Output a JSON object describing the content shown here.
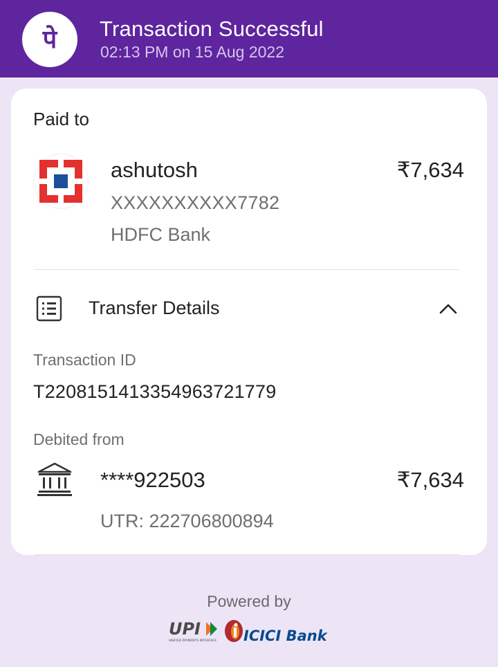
{
  "header": {
    "title": "Transaction Successful",
    "subtitle": "02:13 PM on 15 Aug 2022",
    "logo_glyph": "पे",
    "color": "#5f259f"
  },
  "paid_to": {
    "label": "Paid to",
    "name": "ashutosh",
    "account": "XXXXXXXXXX7782",
    "bank": "HDFC Bank",
    "amount": "₹7,634"
  },
  "transfer_details": {
    "title": "Transfer Details",
    "transaction_id_label": "Transaction ID",
    "transaction_id": "T2208151413354963721779",
    "debited_from_label": "Debited from",
    "debit_account": "****922503",
    "debit_amount": "₹7,634",
    "utr": "UTR: 222706800894"
  },
  "footer": {
    "powered_by": "Powered by",
    "upi_text": "UPI",
    "upi_tagline": "UNIFIED PAYMENTS INTERFACE",
    "bank_text": "ICICI Bank"
  },
  "icons": [
    "phonepe-logo",
    "hdfc-bank-logo",
    "list-icon",
    "chevron-up-icon",
    "bank-icon",
    "upi-logo",
    "icici-logo"
  ]
}
